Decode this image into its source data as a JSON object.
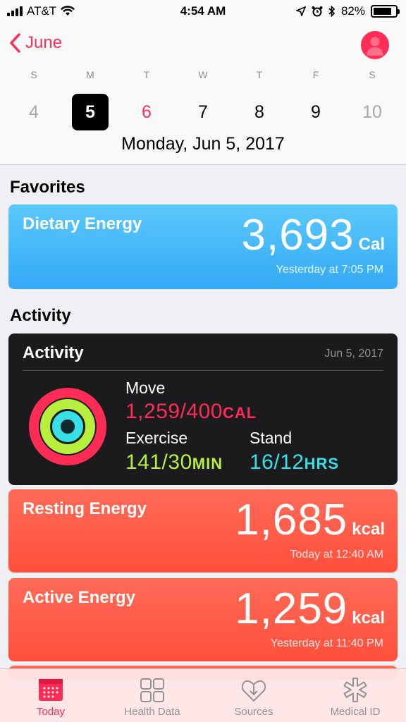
{
  "status_bar": {
    "carrier": "AT&T",
    "time": "4:54 AM",
    "battery": "82%"
  },
  "nav": {
    "back_label": "June"
  },
  "week": {
    "weekdays": [
      "S",
      "M",
      "T",
      "W",
      "T",
      "F",
      "S"
    ],
    "days": [
      "4",
      "5",
      "6",
      "7",
      "8",
      "9",
      "10"
    ],
    "selected_day": "5",
    "today_day": "6",
    "full_date": "Monday, Jun 5, 2017"
  },
  "sections": {
    "favorites": "Favorites",
    "activity": "Activity"
  },
  "dietary": {
    "title": "Dietary Energy",
    "value": "3,693",
    "unit": "Cal",
    "time": "Yesterday at 7:05 PM"
  },
  "activity_card": {
    "title": "Activity",
    "date": "Jun 5, 2017",
    "move_label": "Move",
    "move_value": "1,259/400",
    "move_unit": "CAL",
    "exercise_label": "Exercise",
    "exercise_value": "141/30",
    "exercise_unit": "MIN",
    "stand_label": "Stand",
    "stand_value": "16/12",
    "stand_unit": "HRS"
  },
  "resting": {
    "title": "Resting Energy",
    "value": "1,685",
    "unit": "kcal",
    "time": "Today at 12:40 AM"
  },
  "active": {
    "title": "Active Energy",
    "value": "1,259",
    "unit": "kcal",
    "time": "Yesterday at 11:40 PM"
  },
  "tabs": [
    {
      "label": "Today",
      "icon": "calendar-icon"
    },
    {
      "label": "Health Data",
      "icon": "grid-icon"
    },
    {
      "label": "Sources",
      "icon": "heart-download-icon"
    },
    {
      "label": "Medical ID",
      "icon": "asterisk-icon"
    }
  ],
  "colors": {
    "accent": "#ff2d55",
    "dietary": "#5ac8fa",
    "energy": "#ff5a45",
    "move": "#ff2d55",
    "exercise": "#b6f03d",
    "stand": "#35e0e6"
  }
}
